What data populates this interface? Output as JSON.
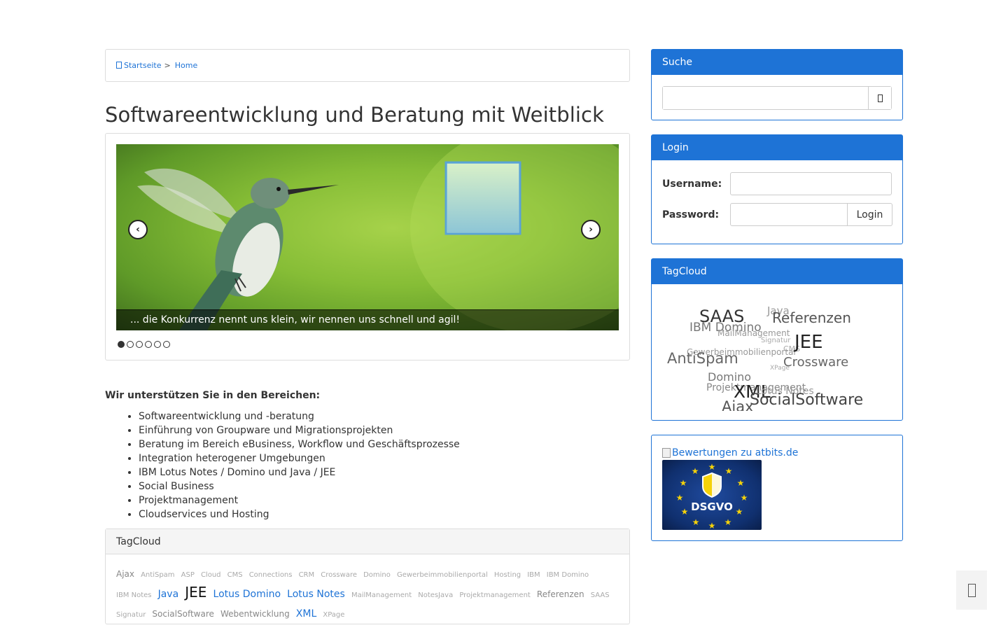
{
  "breadcrumb": {
    "items": [
      {
        "label": "Startseite"
      },
      {
        "separator": ">"
      },
      {
        "label": "Home"
      }
    ]
  },
  "page": {
    "title": "Softwareentwicklung und Beratung mit Weitblick"
  },
  "slider": {
    "caption": "... die Konkurrenz nennt uns klein, wir nennen uns schnell und agil!",
    "prev_icon": "chevron-left-icon",
    "next_icon": "chevron-right-icon",
    "slide_count": 6,
    "active_index": 0
  },
  "content": {
    "intro": "Wir unterstützen Sie in den Bereichen:",
    "bullets": [
      "Softwareentwicklung und -beratung",
      "Einführung von Groupware und Migrationsprojekten",
      "Beratung im Bereich eBusiness, Workflow und Geschäftsprozesse",
      "Integration heterogener Umgebungen",
      "IBM Lotus Notes / Domino und Java / JEE",
      "Social Business",
      "Projektmanagement",
      "Cloudservices und Hosting"
    ]
  },
  "tag_panel": {
    "title": "TagCloud",
    "tags": [
      {
        "label": "Ajax",
        "size": "sm"
      },
      {
        "label": "AntiSpam",
        "size": "xs"
      },
      {
        "label": "ASP",
        "size": "xs"
      },
      {
        "label": "Cloud",
        "size": "xs"
      },
      {
        "label": "CMS",
        "size": "xs"
      },
      {
        "label": "Connections",
        "size": "xs"
      },
      {
        "label": "CRM",
        "size": "xs"
      },
      {
        "label": "Crossware",
        "size": "xs"
      },
      {
        "label": "Domino",
        "size": "xs"
      },
      {
        "label": "Gewerbeimmobilienportal",
        "size": "xs"
      },
      {
        "label": "Hosting",
        "size": "xs"
      },
      {
        "label": "IBM",
        "size": "xs"
      },
      {
        "label": "IBM Domino",
        "size": "xs"
      },
      {
        "label": "IBM Notes",
        "size": "xs"
      },
      {
        "label": "Java",
        "size": "md"
      },
      {
        "label": "JEE",
        "size": "lg"
      },
      {
        "label": "Lotus Domino",
        "size": "md"
      },
      {
        "label": "Lotus Notes",
        "size": "md"
      },
      {
        "label": "MailManagement",
        "size": "xs"
      },
      {
        "label": "NotesJava",
        "size": "xs"
      },
      {
        "label": "Projektmanagement",
        "size": "xs"
      },
      {
        "label": "Referenzen",
        "size": "sm"
      },
      {
        "label": "SAAS",
        "size": "xs"
      },
      {
        "label": "Signatur",
        "size": "xs"
      },
      {
        "label": "SocialSoftware",
        "size": "sm"
      },
      {
        "label": "Webentwicklung",
        "size": "sm"
      },
      {
        "label": "XML",
        "size": "md"
      },
      {
        "label": "XPage",
        "size": "xs"
      }
    ]
  },
  "sidebar": {
    "search": {
      "title": "Suche",
      "value": "",
      "button_icon": "search-icon"
    },
    "login": {
      "title": "Login",
      "username_label": "Username:",
      "password_label": "Password:",
      "username_value": "",
      "password_value": "",
      "button_label": "Login"
    },
    "tagcloud": {
      "title": "TagCloud",
      "words": [
        {
          "text": "SAAS",
          "color": "#333333"
        },
        {
          "text": "Java",
          "color": "#999999"
        },
        {
          "text": "Referenzen",
          "color": "#555555"
        },
        {
          "text": "IBM Domino",
          "color": "#777777"
        },
        {
          "text": "MailManagement",
          "color": "#999999"
        },
        {
          "text": "Signatur",
          "color": "#aaaaaa"
        },
        {
          "text": "CMS",
          "color": "#aaaaaa"
        },
        {
          "text": "Gewerbeimmobilienportal",
          "color": "#999999"
        },
        {
          "text": "JEE",
          "color": "#222222"
        },
        {
          "text": "AntiSpam",
          "color": "#666666"
        },
        {
          "text": "XPage",
          "color": "#aaaaaa"
        },
        {
          "text": "Crossware",
          "color": "#666666"
        },
        {
          "text": "Domino",
          "color": "#777777"
        },
        {
          "text": "Projektmanagement",
          "color": "#888888"
        },
        {
          "text": "XML",
          "color": "#222222"
        },
        {
          "text": "Lotus Notes",
          "color": "#999999"
        },
        {
          "text": "SocialSoftware",
          "color": "#444444"
        },
        {
          "text": "Ajax",
          "color": "#555555"
        }
      ]
    },
    "badges": {
      "rating_link": "Bewertungen zu atbits.de",
      "dsgvo_label": "DSGVO"
    }
  },
  "scroll_top_icon": "arrow-up-icon",
  "colors": {
    "primary": "#1e73d6",
    "panel_border": "#dddddd"
  }
}
